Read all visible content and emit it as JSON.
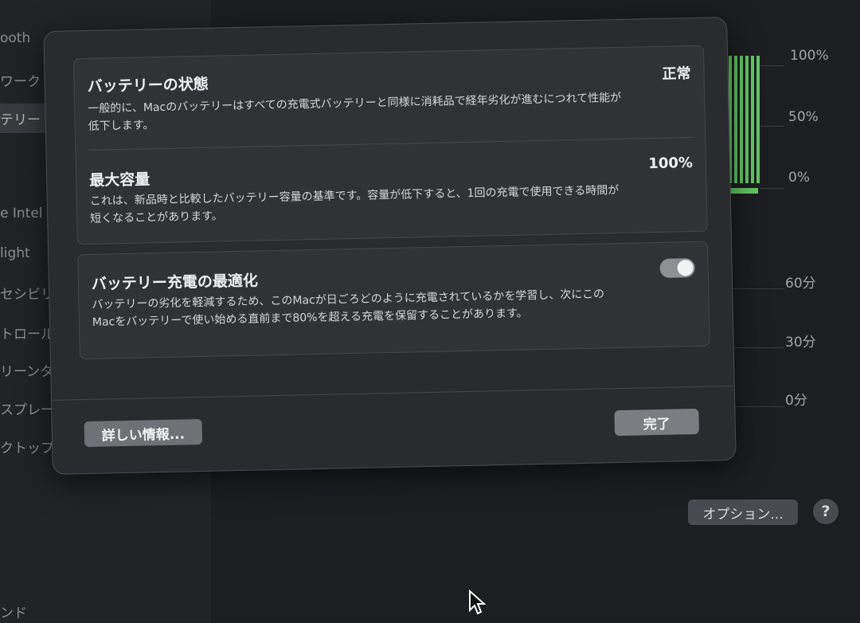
{
  "sidebar": {
    "items": [
      {
        "label": "ooth"
      },
      {
        "label": "ワーク"
      },
      {
        "label": "テリー"
      },
      {
        "label": "e Intel"
      },
      {
        "label": "light"
      },
      {
        "label": "セシビリ"
      },
      {
        "label": "トロール"
      },
      {
        "label": "リーンタ"
      },
      {
        "label": "スプレー"
      },
      {
        "label": "クトップ"
      },
      {
        "label": "ンド"
      }
    ]
  },
  "background": {
    "chart_axis_top": [
      "100%",
      "50%",
      "0%"
    ],
    "chart_axis_bottom": [
      "60分",
      "30分",
      "0分"
    ],
    "options_label": "オプション...",
    "help_label": "?"
  },
  "dialog": {
    "battery_health": {
      "title": "バッテリーの状態",
      "value": "正常",
      "description": "一般的に、Macのバッテリーはすべての充電式バッテリーと同様に消耗品で経年劣化が進むにつれて性能が低下します。"
    },
    "max_capacity": {
      "title": "最大容量",
      "value": "100%",
      "description": "これは、新品時と比較したバッテリー容量の基準です。容量が低下すると、1回の充電で使用できる時間が短くなることがあります。"
    },
    "optimized_charging": {
      "title": "バッテリー充電の最適化",
      "enabled": true,
      "description": "バッテリーの劣化を軽減するため、このMacが日ごろどのように充電されているかを学習し、次にこのMacをバッテリーで使い始める直前まで80%を超える充電を保留することがあります。"
    },
    "more_info_label": "詳しい情報...",
    "done_label": "完了"
  },
  "colors": {
    "chart_green": "#63c766",
    "dialog_bg": "#2a2b2e",
    "button_bg": "#707177"
  }
}
